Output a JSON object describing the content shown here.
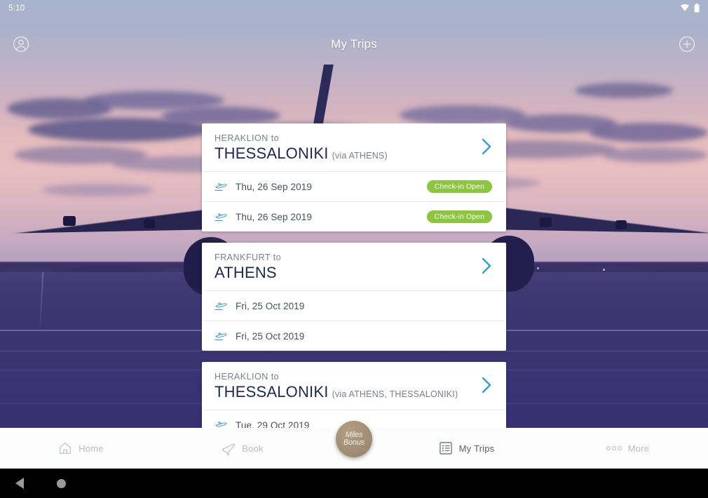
{
  "status_bar": {
    "time": "5:10",
    "icons": [
      "wifi-icon",
      "battery-icon"
    ]
  },
  "app_bar": {
    "title": "My Trips",
    "left_icon": "account-circle-icon",
    "right_icon": "add-circle-icon"
  },
  "theme": {
    "badge_green": "#8cc63e",
    "chevron_blue": "#2f9fd4",
    "route_navy": "#1b2a55",
    "muted_gray": "#7a7f8c",
    "miles_badge_tan": "#9d8a71"
  },
  "trips": [
    {
      "from": "HERAKLION to",
      "to": "THESSALONIKI",
      "via": "(via ATHENS)",
      "chevron": "chevron-right-icon",
      "flights": [
        {
          "icon": "airplane-departure-icon",
          "date": "Thu, 26 Sep 2019",
          "status": "Check-in Open"
        },
        {
          "icon": "airplane-departure-icon",
          "date": "Thu, 26 Sep 2019",
          "status": "Check-in Open"
        }
      ]
    },
    {
      "from": "FRANKFURT to",
      "to": "ATHENS",
      "via": "",
      "chevron": "chevron-right-icon",
      "flights": [
        {
          "icon": "airplane-departure-icon",
          "date": "Fri, 25 Oct 2019",
          "status": ""
        },
        {
          "icon": "airplane-departure-icon",
          "date": "Fri, 25 Oct 2019",
          "status": ""
        }
      ]
    },
    {
      "from": "HERAKLION to",
      "to": "THESSALONIKI",
      "via": "(via ATHENS, THESSALONIKI)",
      "chevron": "chevron-right-icon",
      "flights": [
        {
          "icon": "airplane-departure-icon",
          "date": "Tue, 29 Oct 2019",
          "status": ""
        }
      ]
    }
  ],
  "tab_bar": {
    "items": [
      {
        "label": "Home",
        "icon": "home-icon",
        "active": false
      },
      {
        "label": "Book",
        "icon": "plane-icon",
        "active": false
      },
      {
        "label": "My Trips",
        "icon": "list-icon",
        "active": true
      },
      {
        "label": "More",
        "icon": "dots-icon",
        "active": false
      }
    ],
    "center_badge": {
      "line1": "Miles",
      "line2": "Bonus"
    }
  },
  "android_nav": {
    "back": "back-triangle-icon",
    "home": "home-circle-icon"
  }
}
